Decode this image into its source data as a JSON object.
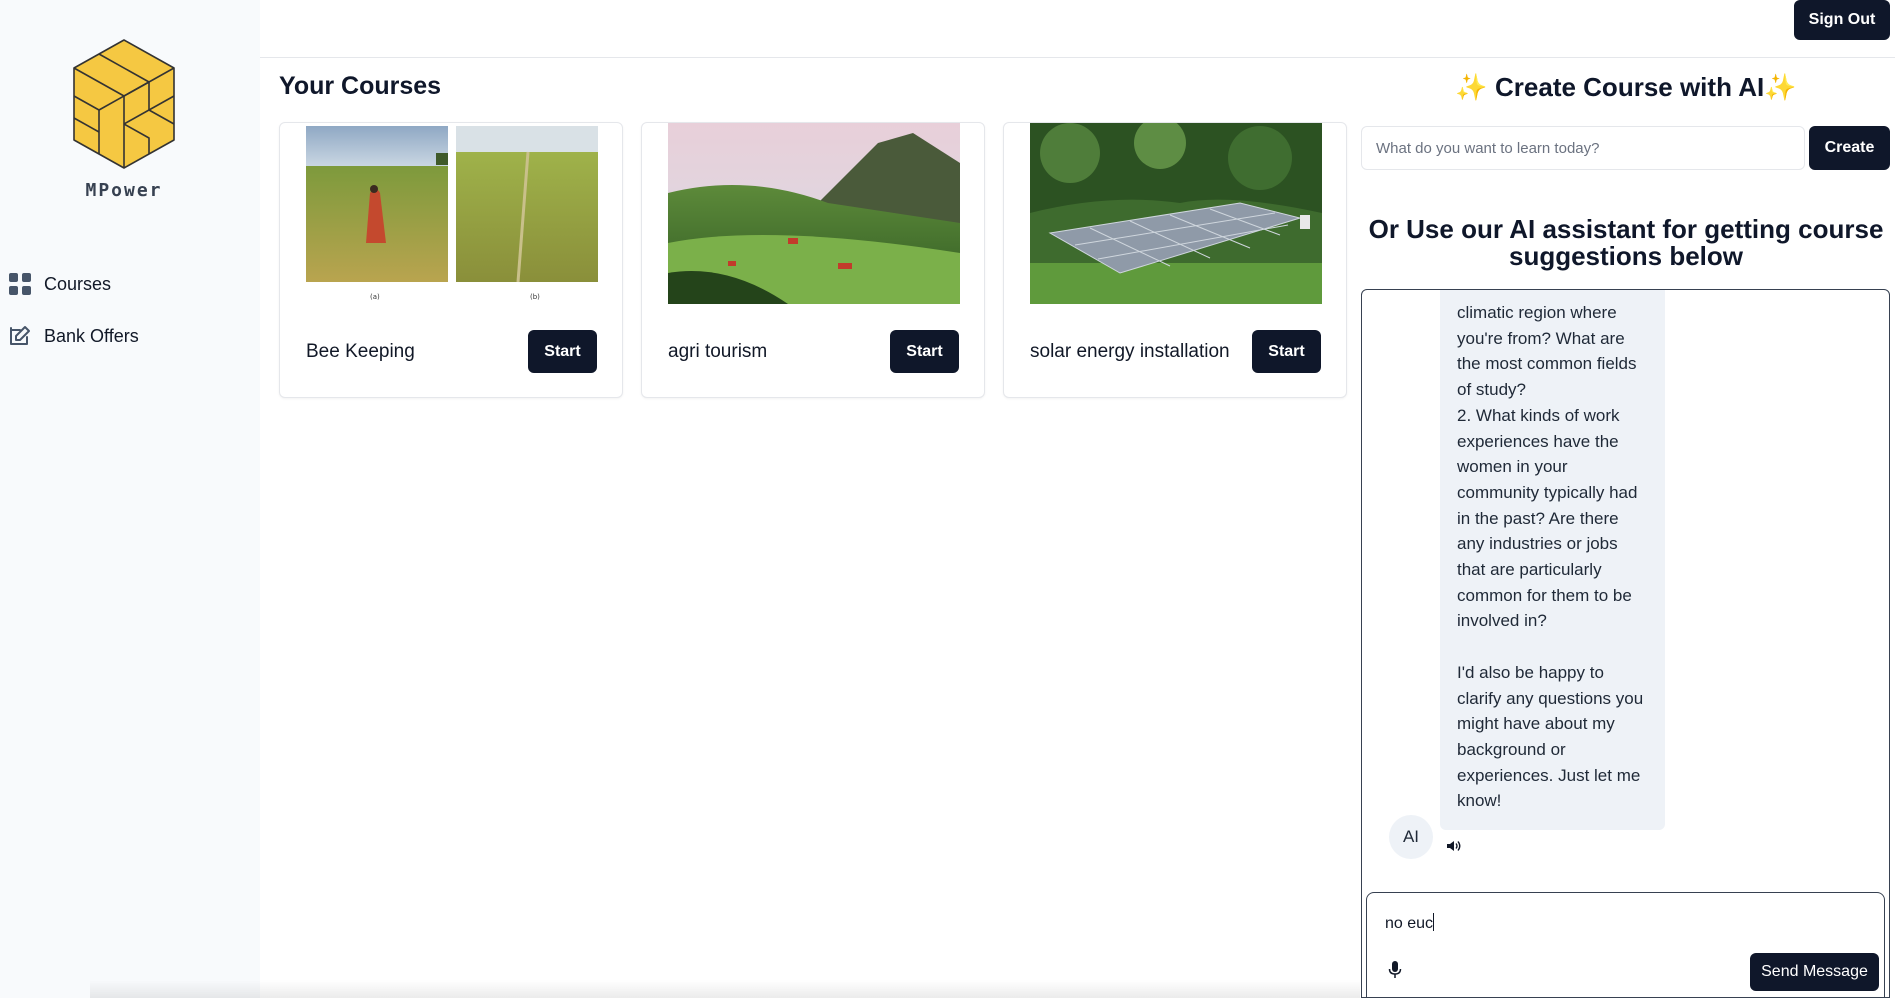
{
  "brand": {
    "name": "MPower"
  },
  "sidebar": {
    "items": [
      {
        "label": "Courses",
        "icon": "grid-icon"
      },
      {
        "label": "Bank Offers",
        "icon": "edit-icon"
      }
    ]
  },
  "header": {
    "signout_label": "Sign Out"
  },
  "courses": {
    "heading": "Your Courses",
    "items": [
      {
        "title": "Bee Keeping",
        "start_label": "Start",
        "image_captions": [
          "(a)",
          "(b)"
        ]
      },
      {
        "title": "agri tourism",
        "start_label": "Start"
      },
      {
        "title": "solar energy installation",
        "start_label": "Start"
      }
    ]
  },
  "create": {
    "title": "✨ Create Course with AI✨",
    "input_placeholder": "What do you want to learn today?",
    "button_label": "Create"
  },
  "assistant": {
    "heading": "Or Use our AI assistant for getting course suggestions below",
    "messages": [
      {
        "sender": "AI",
        "text": "climatic region where you're from? What are the most common fields of study?\n2. What kinds of work experiences have the women in your community typically had in the past? Are there any industries or jobs that are particularly common for them to be involved in?\n\nI'd also be happy to clarify any questions you might have about my background or experiences. Just let me know!"
      }
    ],
    "avatar_label": "AI",
    "composer_value": "no euc",
    "send_label": "Send Message"
  },
  "colors": {
    "primary": "#0f172a",
    "sidebar_bg": "#f8fafc",
    "bubble_bg": "#eef2f7",
    "logo": "#f5c842"
  }
}
